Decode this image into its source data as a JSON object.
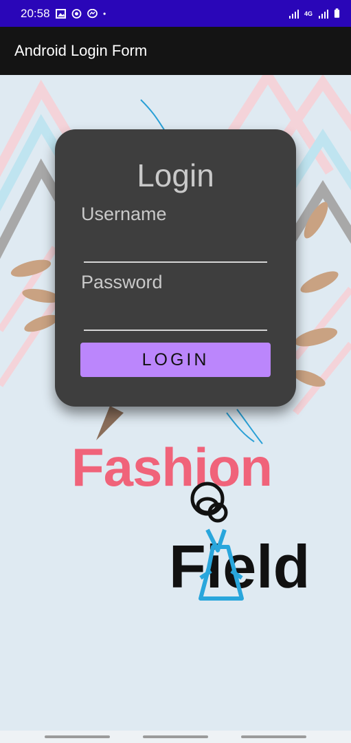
{
  "status_bar": {
    "time": "20:58",
    "left_icons": [
      "image-icon",
      "whatsapp-icon",
      "messenger-icon",
      "dot-icon"
    ],
    "network_label": "4G",
    "right_icons": [
      "signal-icon",
      "signal-icon",
      "battery-icon"
    ]
  },
  "app_bar": {
    "title": "Android Login Form"
  },
  "login": {
    "title": "Login",
    "username_label": "Username",
    "username_value": "",
    "password_label": "Password",
    "password_value": "",
    "button_label": "LOGIN"
  },
  "logo": {
    "line1": "Fashion",
    "line2": "Field"
  },
  "colors": {
    "status_bar": "#2a06b8",
    "app_bar": "#141414",
    "card": "#3e3e3e",
    "button": "#bb86fc",
    "logo_pink": "#f0637a",
    "logo_blue": "#29a6dc"
  }
}
